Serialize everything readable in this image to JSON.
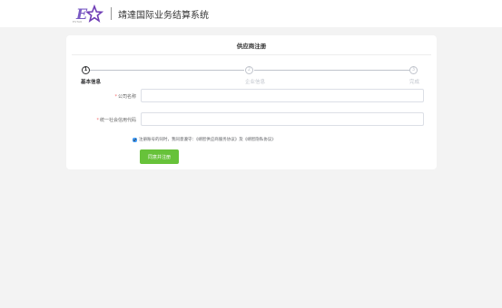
{
  "header": {
    "logo_letters": "E★",
    "logo_caption": "ESTAR",
    "system_title": "靖達国际业务结算系统"
  },
  "page": {
    "title": "供应商注册"
  },
  "steps": [
    {
      "number": "1",
      "label": "基本信息",
      "state": "active"
    },
    {
      "number": "2",
      "label": "企业信息",
      "state": "pending"
    },
    {
      "number": "3",
      "label": "完成",
      "state": "pending"
    }
  ],
  "form": {
    "fields": [
      {
        "required_mark": "*",
        "label": "公司名称",
        "value": ""
      },
      {
        "required_mark": "*",
        "label": "统一社会信用代码",
        "value": ""
      }
    ],
    "agreement": {
      "checked": true,
      "text_prefix": "注册账号的同时，我同意遵守：",
      "link_1": "《靖智供应商服务协议》",
      "text_middle": "及",
      "link_2": "《靖智隐私协议》"
    },
    "submit_label": "同意并注册"
  },
  "colors": {
    "primary": "#409eff",
    "success": "#67c23a",
    "logo_star": "#6f3db5",
    "logo_letter": "#7a5bc4"
  }
}
